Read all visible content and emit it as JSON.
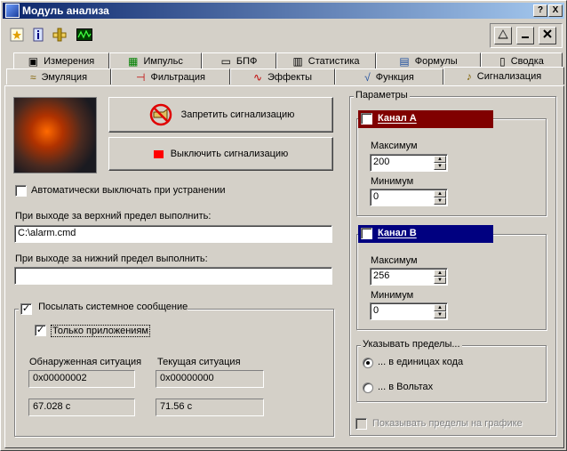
{
  "window": {
    "title": "Модуль анализа"
  },
  "caption_buttons": {
    "help": "?",
    "close": "X"
  },
  "tabs_row1": [
    {
      "label": "Измерения",
      "icon": "meter-icon"
    },
    {
      "label": "Импульс",
      "icon": "grid-icon"
    },
    {
      "label": "БПФ",
      "icon": "fft-icon"
    },
    {
      "label": "Статистика",
      "icon": "bar-chart-icon"
    },
    {
      "label": "Формулы",
      "icon": "calculator-icon"
    },
    {
      "label": "Сводка",
      "icon": "document-icon"
    }
  ],
  "tabs_row2": [
    {
      "label": "Эмуляция",
      "icon": "wave-icon"
    },
    {
      "label": "Фильтрация",
      "icon": "filter-icon"
    },
    {
      "label": "Эффекты",
      "icon": "effects-icon"
    },
    {
      "label": "Функция",
      "icon": "function-icon"
    },
    {
      "label": "Сигнализация",
      "icon": "trumpet-icon",
      "active": true
    }
  ],
  "alarm": {
    "forbid_label": "Запретить сигнализацию",
    "off_label": "Выключить сигнализацию",
    "auto_off_label": "Автоматически выключать при устранении",
    "auto_off_checked": false,
    "upper_label": "При выходе за верхний предел выполнить:",
    "upper_value": "C:\\alarm.cmd",
    "lower_label": "При выходе за нижний предел выполнить:",
    "lower_value": "",
    "send_msg_label": "Посылать системное сообщение",
    "send_msg_checked": true,
    "apps_only_label": "Только приложениям",
    "apps_only_checked": true,
    "detected_label": "Обнаруженная ситуация",
    "current_label": "Текущая ситуация",
    "detected_code": "0x00000002",
    "current_code": "0x00000000",
    "detected_time": "67.028 с",
    "current_time": "71.56 с",
    "off_color": "#ff0000"
  },
  "params": {
    "title": "Параметры",
    "channel_a": {
      "name": "Канал A",
      "checked": true,
      "color": "#800000",
      "max_label": "Максимум",
      "max": "200",
      "min_label": "Минимум",
      "min": "0"
    },
    "channel_b": {
      "name": "Канал B",
      "checked": false,
      "color": "#000080",
      "max_label": "Максимум",
      "max": "256",
      "min_label": "Минимум",
      "min": "0"
    },
    "limits_title": "Указывать пределы...",
    "limits_code": "... в единицах кода",
    "limits_volts": "... в Вольтах",
    "limits_selected": "code",
    "show_on_graph": "Показывать пределы на графике"
  }
}
